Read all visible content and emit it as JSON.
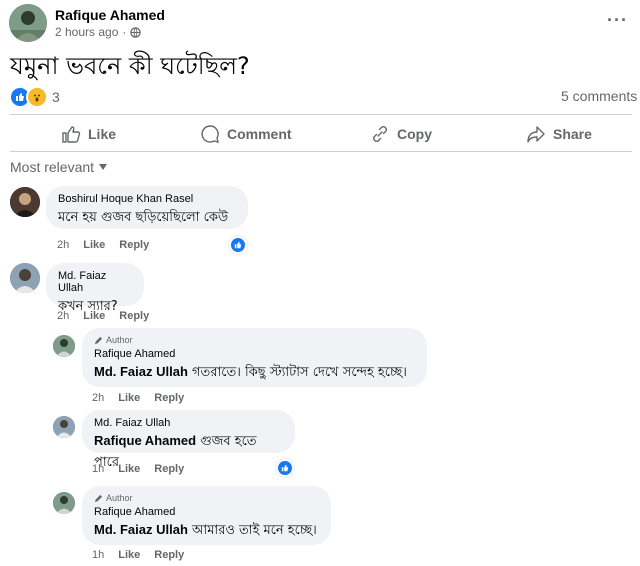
{
  "post": {
    "author": "Rafique Ahamed",
    "time": "2 hours ago",
    "audience_icon": "globe-icon",
    "text": "যমুনা ভবনে কী ঘটেছিল?",
    "reaction_count": "3",
    "comments_label": "5 comments"
  },
  "actions": {
    "like": "Like",
    "comment": "Comment",
    "copy": "Copy",
    "share": "Share"
  },
  "sort_label": "Most relevant",
  "comments": [
    {
      "name": "Boshirul Hoque Khan Rasel",
      "text": "মনে হয় গুজব ছড়িয়েছিলো কেউ",
      "time": "2h",
      "like": "Like",
      "reply": "Reply"
    },
    {
      "name": "Md. Faiaz Ullah",
      "text": "কখন স্যার?",
      "time": "2h",
      "like": "Like",
      "reply": "Reply"
    },
    {
      "badge": "Author",
      "name": "Rafique Ahamed",
      "mention": "Md. Faiaz Ullah",
      "text": " গতরাতে। কিছু স্ট্যাটাস দেখে সন্দেহ হচ্ছে।",
      "time": "2h",
      "like": "Like",
      "reply": "Reply"
    },
    {
      "name": "Md. Faiaz Ullah",
      "mention": "Rafique Ahamed",
      "text": " গুজব হতে পারে",
      "time": "1h",
      "like": "Like",
      "reply": "Reply"
    },
    {
      "badge": "Author",
      "name": "Rafique Ahamed",
      "mention": "Md. Faiaz Ullah",
      "text": " আমারও তাই মনে হচ্ছে।",
      "time": "1h",
      "like": "Like",
      "reply": "Reply"
    }
  ],
  "colors": {
    "accent": "#1877f2",
    "wow": "#f7b928",
    "bubble": "#f0f2f5",
    "meta": "#65676b"
  }
}
